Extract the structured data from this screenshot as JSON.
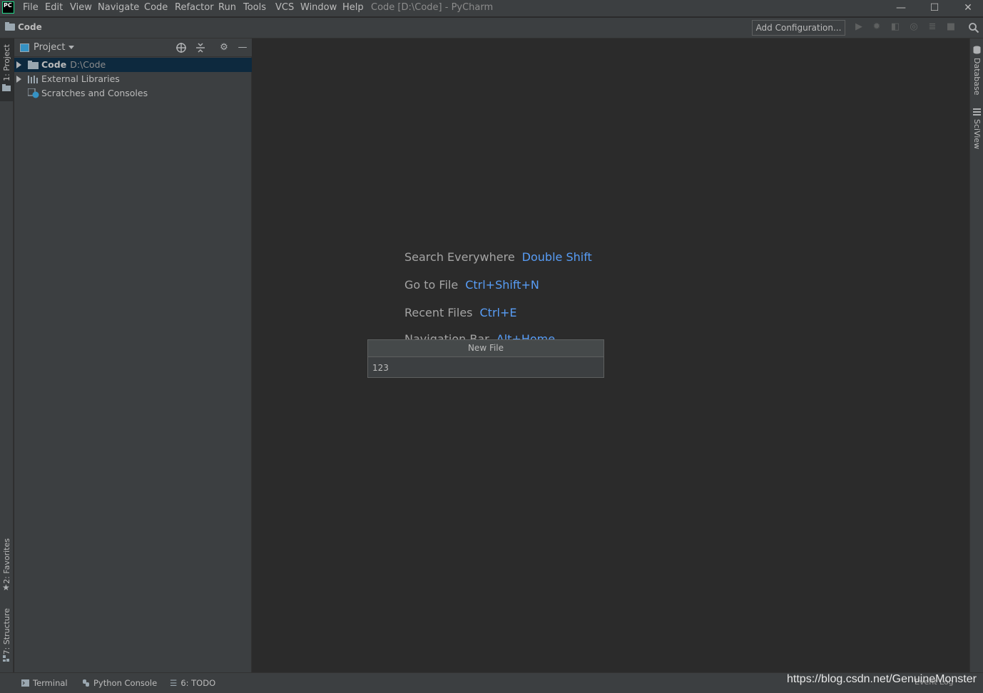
{
  "app": {
    "logo_text_top": "PC",
    "window_title": "Code [D:\\Code] - PyCharm"
  },
  "menu": {
    "items": [
      "File",
      "Edit",
      "View",
      "Navigate",
      "Code",
      "Refactor",
      "Run",
      "Tools",
      "VCS",
      "Window",
      "Help"
    ]
  },
  "window_controls": {
    "minimize": "—",
    "maximize": "☐",
    "close": "✕"
  },
  "navbar": {
    "project_name": "Code",
    "add_configuration_label": "Add Configuration..."
  },
  "left_strip": {
    "project_tab": "1: Project",
    "favorites_tab": "2: Favorites",
    "structure_tab": "7: Structure"
  },
  "right_strip": {
    "database_tab": "Database",
    "sciview_tab": "SciView"
  },
  "project_panel": {
    "title": "Project",
    "tree": [
      {
        "label": "Code",
        "sub": "D:\\Code",
        "expandable": true,
        "selected": true,
        "icon": "folder-icon"
      },
      {
        "label": "External Libraries",
        "sub": "",
        "expandable": true,
        "selected": false,
        "icon": "library-icon"
      },
      {
        "label": "Scratches and Consoles",
        "sub": "",
        "expandable": false,
        "selected": false,
        "icon": "scratches-icon"
      }
    ]
  },
  "editor_hints": [
    {
      "label": "Search Everywhere",
      "key": "Double Shift"
    },
    {
      "label": "Go to File",
      "key": "Ctrl+Shift+N"
    },
    {
      "label": "Recent Files",
      "key": "Ctrl+E"
    },
    {
      "label": "Navigation Bar",
      "key": "Alt+Home"
    }
  ],
  "new_file_popup": {
    "title": "New File",
    "value": "123"
  },
  "bottom_bar": {
    "terminal": "Terminal",
    "python_console": "Python Console",
    "todo": "6: TODO",
    "event_log": "Event Log",
    "watermark": "https://blog.csdn.net/GenuineMonster"
  },
  "colors": {
    "background": "#2b2b2b",
    "panel": "#3c3f41",
    "selection": "#0d293e",
    "shortcut_blue": "#589df6"
  }
}
